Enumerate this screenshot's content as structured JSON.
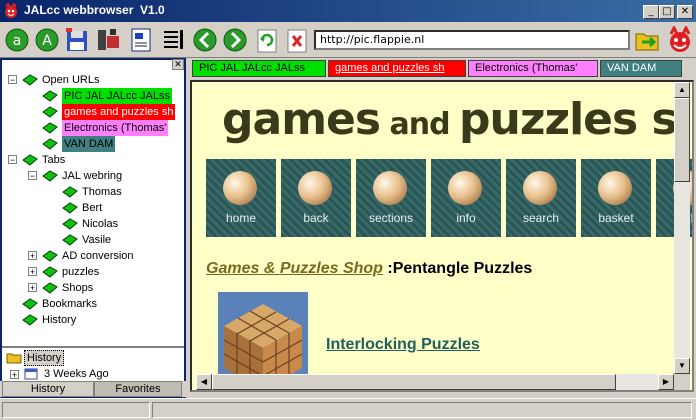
{
  "window": {
    "title": "JALcc webbrowser  V1.0"
  },
  "address": {
    "url": "http://pic.flappie.nl"
  },
  "tree": {
    "open_urls": "Open URLs",
    "open_items": [
      {
        "label": "PIC JAL JALcc JALss",
        "bg": "#00e000",
        "fg": "#000000"
      },
      {
        "label": "games and puzzles sh",
        "bg": "#ff0000",
        "fg": "#ffffff"
      },
      {
        "label": "Electronics (Thomas'",
        "bg": "#ff80ff",
        "fg": "#000000"
      },
      {
        "label": "VAN DAM",
        "bg": "#408080",
        "fg": "#000000"
      }
    ],
    "tabs": "Tabs",
    "jal_webring": "JAL webring",
    "webring_items": [
      "Thomas",
      "Bert",
      "Nicolas",
      "Vasile"
    ],
    "ad_conversion": "AD conversion",
    "puzzles": "puzzles",
    "shops": "Shops",
    "bookmarks": "Bookmarks",
    "history": "History"
  },
  "history_panel": {
    "title": "History",
    "item": "3 Weeks Ago"
  },
  "bottom_tabs": {
    "history": "History",
    "favorites": "Favorites"
  },
  "content_tabs": [
    {
      "label": "PIC JAL JALcc JALss",
      "bg": "#00e000",
      "fg": "#000000"
    },
    {
      "label": "games and puzzles sh",
      "bg": "#ff0000",
      "fg": "#ffffff"
    },
    {
      "label": "Electronics (Thomas'",
      "bg": "#ff80ff",
      "fg": "#000000"
    },
    {
      "label": "VAN DAM",
      "bg": "#408080",
      "fg": "#ffffff"
    }
  ],
  "page": {
    "heading_1": "games",
    "heading_and": " and ",
    "heading_2": "puzzles s",
    "nav": [
      "home",
      "back",
      "sections",
      "info",
      "search",
      "basket",
      "ch"
    ],
    "shop_link": "Games & Puzzles Shop",
    "shop_sep": " :",
    "shop_rest": "Pentangle Puzzles",
    "interlocking": "Interlocking Puzzles"
  },
  "icons": {
    "app": "jalcc-face-icon",
    "toolbar": [
      "a-globe-icon",
      "a-globe-icon",
      "save-disk-icon",
      "tools-icon",
      "document-icon",
      "list-icon",
      "back-arrow-icon",
      "forward-arrow-icon",
      "refresh-icon",
      "stop-icon"
    ],
    "go": "go-folder-icon",
    "face": "jalcc-face-icon"
  }
}
